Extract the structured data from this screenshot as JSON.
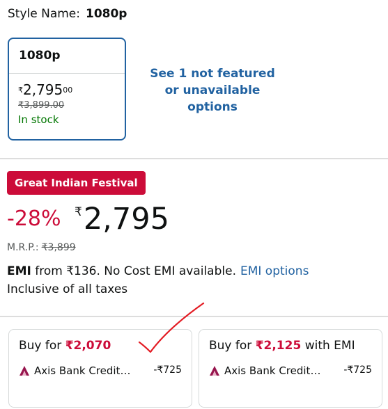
{
  "style": {
    "label": "Style Name:",
    "value": "1080p"
  },
  "option_card": {
    "title": "1080p",
    "price_symbol": "₹",
    "price_whole": "2,795",
    "price_fraction": "00",
    "mrp": "₹3,899.00",
    "stock": "In stock"
  },
  "see_more": {
    "line1": "See 1 not featured",
    "line2": "or unavailable",
    "line3": "options"
  },
  "deal": {
    "badge": "Great Indian Festival"
  },
  "pricing": {
    "discount": "-28%",
    "symbol": "₹",
    "price": "2,795",
    "mrp_label": "M.R.P.:",
    "mrp": "₹3,899"
  },
  "emi": {
    "strong": "EMI",
    "text": " from ₹136. No Cost EMI available.",
    "link": "EMI options"
  },
  "taxes": "Inclusive of all taxes",
  "offers": [
    {
      "buy_prefix": "Buy for ",
      "amount": "₹2,070",
      "buy_suffix": "",
      "bank": "Axis Bank Credit…",
      "saving": "-₹725"
    },
    {
      "buy_prefix": "Buy for ",
      "amount": "₹2,125",
      "buy_suffix": " with EMI",
      "bank": "Axis Bank Credit…",
      "saving": "-₹725"
    }
  ],
  "colors": {
    "accent_blue": "#2162a1",
    "deal_red": "#cc0c39",
    "stock_green": "#007600",
    "axis_logo": "#97144d",
    "annotation_red": "#e31b23"
  }
}
